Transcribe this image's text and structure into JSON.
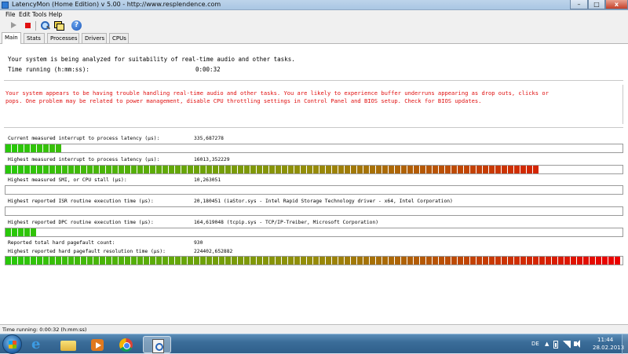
{
  "window": {
    "title": "LatencyMon  (Home Edition)  v 5.00 - http://www.resplendence.com",
    "minimize_glyph": "–",
    "maximize_glyph": "□",
    "close_glyph": "x"
  },
  "menu": [
    "File",
    "Edit",
    "Tools",
    "Help"
  ],
  "toolbar": {
    "icons": [
      "play-icon",
      "stop-icon",
      "search-icon",
      "windows-icon",
      "help-icon"
    ],
    "help_glyph": "?"
  },
  "tabs": [
    "Main",
    "Stats",
    "Processes",
    "Drivers",
    "CPUs"
  ],
  "status": {
    "line1": "Your system is being analyzed for suitability of real-time audio and other tasks.",
    "time_label": "Time running (h:mm:ss):",
    "time_value": "0:00:32"
  },
  "warning": {
    "line1": "Your system appears to be having trouble handling real-time audio and other tasks. You are likely to experience buffer underruns appearing as drop outs, clicks or",
    "line2": "pops. One problem may be related to power management, disable CPU throttling settings in Control Panel and BIOS setup. Check for BIOS updates.",
    "color": "#e01010"
  },
  "metrics": [
    {
      "label": "Current measured interrupt to process latency (µs):",
      "value": "335,687278",
      "fill": 0.095
    },
    {
      "label": "Highest measured interrupt to process latency (µs):",
      "value": "16013,352229",
      "fill": 0.87
    },
    {
      "label": "Highest measured SMI, or CPU stall (µs):",
      "value": "10,263051",
      "fill": 0
    },
    {
      "label": "Highest reported ISR routine execution time (µs):",
      "value": "20,180451  (iaStor.sys - Intel Rapid Storage Technology driver - x64, Intel Corporation)",
      "fill": 0
    },
    {
      "label": "Highest reported DPC routine execution time (µs):",
      "value": "164,619048  (tcpip.sys - TCP/IP-Treiber, Microsoft Corporation)",
      "fill": 0.046
    },
    {
      "label": "Reported total hard pagefault count:",
      "value": "930",
      "fill": null
    },
    {
      "label": "Highest reported hard pagefault resolution time (µs):",
      "value": "224402,652882",
      "fill": 1.0
    }
  ],
  "statusbar": {
    "text": "Time running: 0:00:32  (h:mm:ss)"
  },
  "taskbar": {
    "apps": [
      "internet-explorer",
      "windows-explorer",
      "media-player",
      "google-chrome",
      "latencymon"
    ],
    "language": "DE",
    "tray_arrow": "▲",
    "time": "11:44",
    "date": "28.02.2013"
  }
}
